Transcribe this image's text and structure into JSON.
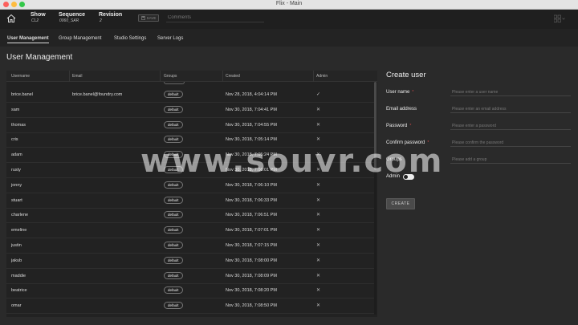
{
  "window": {
    "title": "Flix - Main"
  },
  "header": {
    "show_label": "Show",
    "show_value": "CL2",
    "sequence_label": "Sequence",
    "sequence_value": "0060_SAR",
    "revision_label": "Revision",
    "revision_value": "2",
    "save_label": "SAVE",
    "comments_placeholder": "Comments"
  },
  "tabs": [
    {
      "label": "User Management",
      "active": true
    },
    {
      "label": "Group Management",
      "active": false
    },
    {
      "label": "Studio Settings",
      "active": false
    },
    {
      "label": "Server Logs",
      "active": false
    }
  ],
  "page_title": "User Management",
  "table": {
    "columns": [
      "Username",
      "Email",
      "Groups",
      "Created",
      "Admin"
    ],
    "rows": [
      {
        "username": "brice.banel",
        "email": "brice.banel@foundry.com",
        "group": "default",
        "created": "Nov 28, 2018, 4:04:14 PM",
        "admin": "✓"
      },
      {
        "username": "sam",
        "email": "",
        "group": "default",
        "created": "Nov 30, 2018, 7:04:41 PM",
        "admin": "✕"
      },
      {
        "username": "thomas",
        "email": "",
        "group": "default",
        "created": "Nov 30, 2018, 7:04:55 PM",
        "admin": "✕"
      },
      {
        "username": "cris",
        "email": "",
        "group": "default",
        "created": "Nov 30, 2018, 7:05:14 PM",
        "admin": "✕"
      },
      {
        "username": "adam",
        "email": "",
        "group": "default",
        "created": "Nov 30, 2018, 7:05:24 PM",
        "admin": "✕"
      },
      {
        "username": "rusty",
        "email": "",
        "group": "default",
        "created": "Nov 30, 2018, 7:06:01 PM",
        "admin": "✕"
      },
      {
        "username": "jonny",
        "email": "",
        "group": "default",
        "created": "Nov 30, 2018, 7:06:10 PM",
        "admin": "✕"
      },
      {
        "username": "stuart",
        "email": "",
        "group": "default",
        "created": "Nov 30, 2018, 7:06:33 PM",
        "admin": "✕"
      },
      {
        "username": "charlene",
        "email": "",
        "group": "default",
        "created": "Nov 30, 2018, 7:06:51 PM",
        "admin": "✕"
      },
      {
        "username": "emeline",
        "email": "",
        "group": "default",
        "created": "Nov 30, 2018, 7:07:01 PM",
        "admin": "✕"
      },
      {
        "username": "justin",
        "email": "",
        "group": "default",
        "created": "Nov 30, 2018, 7:07:15 PM",
        "admin": "✕"
      },
      {
        "username": "jakub",
        "email": "",
        "group": "default",
        "created": "Nov 30, 2018, 7:08:00 PM",
        "admin": "✕"
      },
      {
        "username": "maddie",
        "email": "",
        "group": "default",
        "created": "Nov 30, 2018, 7:08:09 PM",
        "admin": "✕"
      },
      {
        "username": "beatrice",
        "email": "",
        "group": "default",
        "created": "Nov 30, 2018, 7:08:20 PM",
        "admin": "✕"
      },
      {
        "username": "omar",
        "email": "",
        "group": "default",
        "created": "Nov 30, 2018, 7:08:50 PM",
        "admin": "✕"
      }
    ]
  },
  "create_user": {
    "title": "Create user",
    "username_label": "User name",
    "username_placeholder": "Please enter a user name",
    "email_label": "Email address",
    "email_placeholder": "Please enter an email address",
    "password_label": "Password",
    "password_placeholder": "Please enter a password",
    "confirm_label": "Confirm password",
    "confirm_placeholder": "Please confirm the password",
    "groups_label": "Groups",
    "groups_placeholder": "Please add a group",
    "admin_label": "Admin",
    "admin_enabled": false,
    "create_label": "CREATE",
    "required_mark": "*"
  },
  "watermark": "www.souvr.com"
}
